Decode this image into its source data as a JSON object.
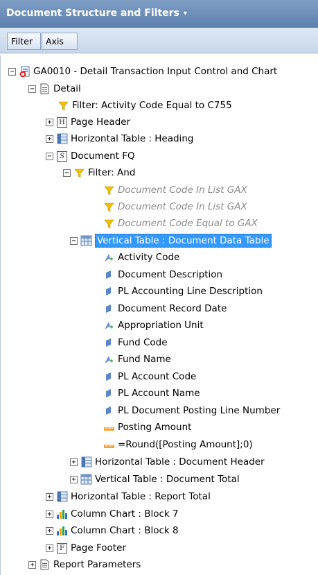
{
  "panel": {
    "title": "Document Structure and Filters",
    "title_caret": "▾"
  },
  "tabs": [
    {
      "label": "Filter"
    },
    {
      "label": "Axis"
    }
  ],
  "tree": {
    "root": "GA0010 - Detail Transaction Input Control and Chart",
    "detail": "Detail",
    "detail_filter": "Filter: Activity Code Equal to C755",
    "page_header": "Page Header",
    "horizontal_heading": "Horizontal Table : Heading",
    "document_fq": "Document FQ",
    "filter_and": "Filter: And",
    "doc_filters": [
      "Document Code In List GAX",
      "Document Code In List GAX",
      "Document Code Equal to GAX"
    ],
    "vertical_table": "Vertical Table : Document Data Table",
    "columns": [
      {
        "label": "Activity Code",
        "icon": "dimension-icon"
      },
      {
        "label": "Document Description",
        "icon": "detail-icon"
      },
      {
        "label": "PL Accounting Line Description",
        "icon": "detail-icon"
      },
      {
        "label": "Document Record Date",
        "icon": "detail-icon"
      },
      {
        "label": "Appropriation Unit",
        "icon": "dimension-icon"
      },
      {
        "label": "Fund Code",
        "icon": "detail-icon"
      },
      {
        "label": "Fund Name",
        "icon": "dimension-icon"
      },
      {
        "label": "PL Account Code",
        "icon": "detail-icon"
      },
      {
        "label": "PL Account Name",
        "icon": "detail-icon"
      },
      {
        "label": "PL Document Posting Line Number",
        "icon": "detail-icon"
      },
      {
        "label": "Posting Amount",
        "icon": "measure-icon"
      },
      {
        "label": "=Round([Posting Amount];0)",
        "icon": "measure-icon"
      }
    ],
    "horizontal_doc_header": "Horizontal Table : Document Header",
    "vertical_doc_total": "Vertical Table : Document Total",
    "horizontal_report_total": "Horizontal Table : Report Total",
    "column_chart_7": "Column Chart : Block 7",
    "column_chart_8": "Column Chart : Block 8",
    "page_footer": "Page Footer",
    "report_parameters": "Report Parameters"
  },
  "glyphs": {
    "expand": "+",
    "collapse": "−",
    "header_letter": "H",
    "section_letter": "S",
    "footer_letter": "F"
  },
  "colors": {
    "selection": "#3399ff",
    "filter_icon": "#f2c200",
    "detail_icon": "#5b87c7",
    "dimension_icon": "#6b8fcf",
    "measure_icon": "#f2a23a"
  }
}
